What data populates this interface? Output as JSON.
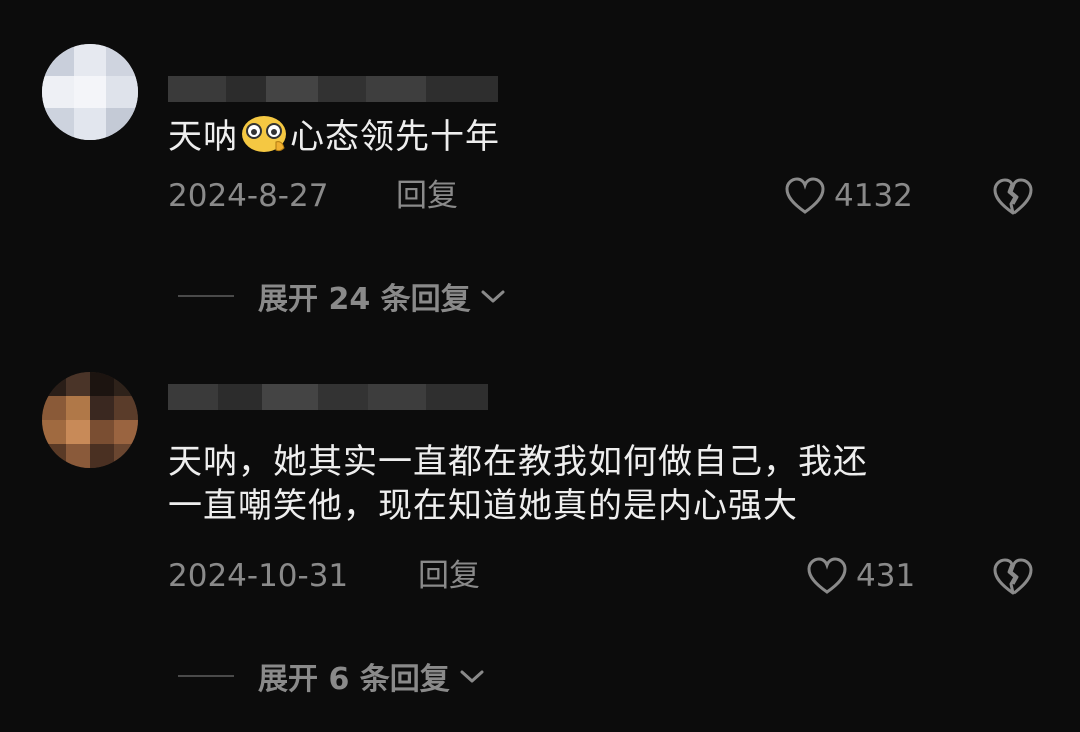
{
  "comments": [
    {
      "username": "",
      "text_before_emoji": "天呐",
      "emoji": "face-with-monocle-emoji",
      "text_after_emoji": "心态领先十年",
      "date": "2024-8-27",
      "reply_label": "回复",
      "like_count": "4132",
      "expand_label": "展开 24 条回复"
    },
    {
      "username": "",
      "text_line1": "天呐，她其实一直都在教我如何做自己，我还",
      "text_line2": "一直嘲笑他，现在知道她真的是内心强大",
      "date": "2024-10-31",
      "reply_label": "回复",
      "like_count": "431",
      "expand_label": "展开 6 条回复"
    }
  ],
  "colors": {
    "background": "#0c0c0c",
    "primary_text": "#eeeeee",
    "secondary_text": "#8a8a8a"
  }
}
